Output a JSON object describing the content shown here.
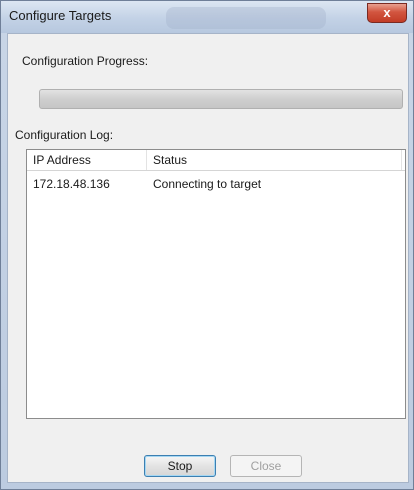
{
  "window": {
    "title": "Configure Targets",
    "close_glyph": "x"
  },
  "progress": {
    "label": "Configuration Progress:",
    "value": 0
  },
  "log": {
    "label": "Configuration Log:",
    "columns": [
      "IP Address",
      "Status"
    ],
    "rows": [
      {
        "ip": "172.18.48.136",
        "status": "Connecting to target"
      }
    ]
  },
  "buttons": {
    "stop": "Stop",
    "close": "Close"
  },
  "colors": {
    "titlebar": "#c3d2e6",
    "close_button": "#c23c26",
    "dialog_background": "#f0f0f0",
    "default_button_border": "#3c7fb1"
  },
  "icons": {
    "close": "close-icon"
  }
}
